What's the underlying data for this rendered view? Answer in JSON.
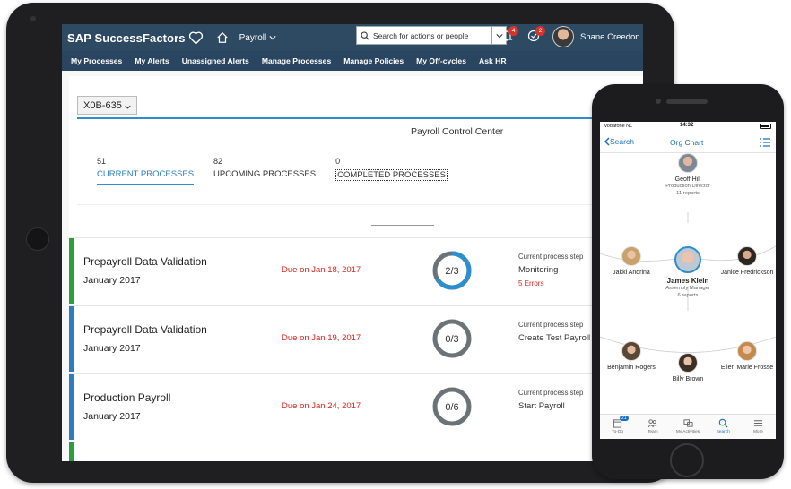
{
  "tablet": {
    "brand": "SAP SuccessFactors",
    "module": "Payroll",
    "search_placeholder": "Search for actions or people",
    "notif_count": "4",
    "approval_count": "2",
    "user_name": "Shane Creedon",
    "nav": [
      "My Processes",
      "My Alerts",
      "Unassigned Alerts",
      "Manage Processes",
      "Manage Policies",
      "My Off-cycles",
      "Ask HR"
    ],
    "selector_value": "X0B-635",
    "page_title": "Payroll Control Center",
    "tabs": [
      {
        "count": "51",
        "label": "CURRENT PROCESSES"
      },
      {
        "count": "82",
        "label": "UPCOMING PROCESSES"
      },
      {
        "count": "0",
        "label": "COMPLETED PROCESSES"
      }
    ],
    "processes": [
      {
        "title": "Prepayroll Data Validation",
        "period": "January 2017",
        "due": "Due on Jan 18, 2017",
        "progress": "2/3",
        "step_label": "Current process step",
        "step": "Monitoring",
        "errors": "5 Errors",
        "status_color": "#2e9c3f",
        "progress_fraction": 0.667
      },
      {
        "title": "Prepayroll Data Validation",
        "period": "January 2017",
        "due": "Due on Jan 19, 2017",
        "progress": "0/3",
        "step_label": "Current process step",
        "step": "Create Test Payroll",
        "errors": "",
        "status_color": "#2b7dc0",
        "progress_fraction": 0
      },
      {
        "title": "Production Payroll",
        "period": "January 2017",
        "due": "Due on Jan 24, 2017",
        "progress": "0/6",
        "step_label": "Current process step",
        "step": "Start Payroll",
        "errors": "",
        "status_color": "#2b7dc0",
        "progress_fraction": 0
      }
    ],
    "colors": {
      "shell": "#2e4a63",
      "accent": "#2b8ece",
      "due": "#d4241b"
    }
  },
  "phone": {
    "carrier": "vodafone NL",
    "time": "14:32",
    "back_label": "Search",
    "title": "Org Chart",
    "manager": {
      "name": "Geoff Hill",
      "role": "Production Director",
      "reports": "11 reports"
    },
    "focus": {
      "name": "James Klein",
      "role": "Assembly Manager",
      "reports": "6 reports"
    },
    "peers": [
      {
        "name": "Jakki Andrina"
      },
      {
        "name": "Janice Fredrickson"
      }
    ],
    "reports": [
      {
        "name": "Benjamin Rogers"
      },
      {
        "name": "Billy Brown"
      },
      {
        "name": "Ellen Marie Frosse"
      }
    ],
    "tabbar": [
      {
        "label": "To-Do",
        "icon": "todo-icon",
        "badge": "21"
      },
      {
        "label": "Team",
        "icon": "team-icon"
      },
      {
        "label": "My Activities",
        "icon": "activities-icon"
      },
      {
        "label": "Search",
        "icon": "search-icon"
      },
      {
        "label": "More",
        "icon": "more-icon"
      }
    ]
  }
}
